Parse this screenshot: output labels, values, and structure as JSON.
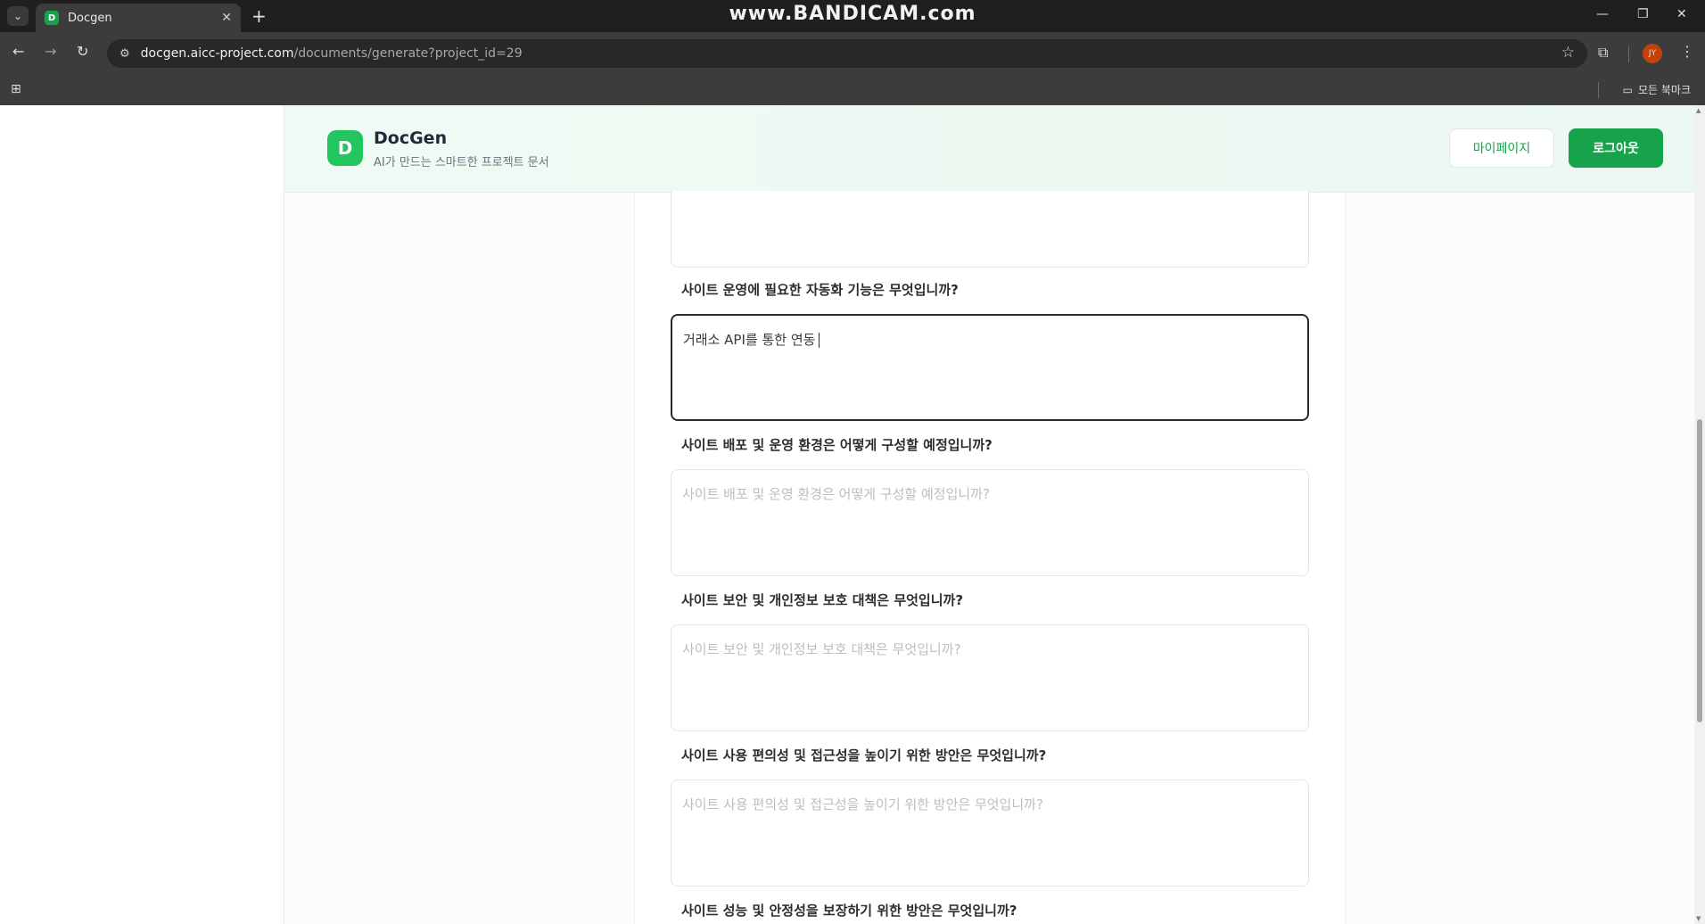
{
  "browser": {
    "tab_title": "Docgen",
    "tab_favicon_letter": "D",
    "watermark": "www.BANDICAM.com",
    "url_host": "docgen.aicc-project.com",
    "url_path": "/documents/generate?project_id=29",
    "profile_initials": "JY",
    "bookmarks_folder": "모든 북마크"
  },
  "app": {
    "logo_letter": "D",
    "brand_name": "DocGen",
    "brand_subtitle": "AI가 만드는 스마트한 프로젝트 문서",
    "mypage_label": "마이페이지",
    "logout_label": "로그아웃",
    "accent_color": "#16a34a"
  },
  "form": {
    "questions": [
      {
        "label": "사이트 운영에 필요한 자동화 기능은 무엇입니까?",
        "value": "거래소 API를 통한 연동",
        "placeholder": ""
      },
      {
        "label": "사이트 배포 및 운영 환경은 어떻게 구성할 예정입니까?",
        "value": "",
        "placeholder": "사이트 배포 및 운영 환경은 어떻게 구성할 예정입니까?"
      },
      {
        "label": "사이트 보안 및 개인정보 보호 대책은 무엇입니까?",
        "value": "",
        "placeholder": "사이트 보안 및 개인정보 보호 대책은 무엇입니까?"
      },
      {
        "label": "사이트 사용 편의성 및 접근성을 높이기 위한 방안은 무엇입니까?",
        "value": "",
        "placeholder": "사이트 사용 편의성 및 접근성을 높이기 위한 방안은 무엇입니까?"
      },
      {
        "label": "사이트 성능 및 안정성을 보장하기 위한 방안은 무엇입니까?"
      }
    ]
  }
}
